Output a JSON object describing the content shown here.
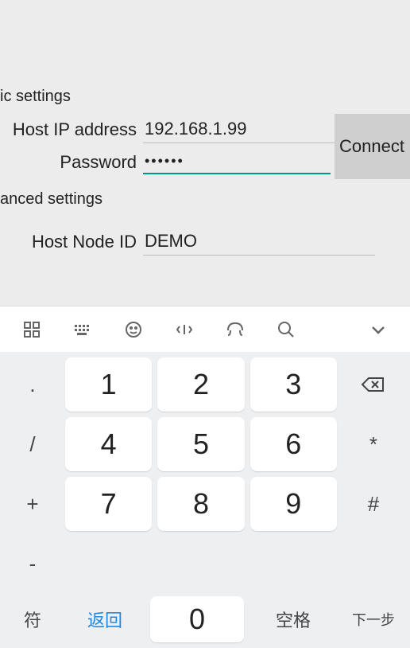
{
  "sections": {
    "basic_header": "ic settings",
    "advanced_header": "anced settings"
  },
  "form": {
    "host_ip_label": "Host IP address",
    "host_ip_value": "192.168.1.99",
    "password_label": "Password",
    "password_value": "••••••",
    "host_node_label": "Host Node ID",
    "host_node_value": "DEMO",
    "connect_label": "Connect"
  },
  "keyboard": {
    "symbols": {
      "dot": ".",
      "slash": "/",
      "plus": "+",
      "minus": "-"
    },
    "digits": {
      "d1": "1",
      "d2": "2",
      "d3": "3",
      "d4": "4",
      "d5": "5",
      "d6": "6",
      "d7": "7",
      "d8": "8",
      "d9": "9",
      "d0": "0"
    },
    "side": {
      "star": "*",
      "hash": "#"
    },
    "bottom": {
      "mode": "符",
      "return": "返回",
      "space": "空格",
      "next": "下一步"
    }
  }
}
